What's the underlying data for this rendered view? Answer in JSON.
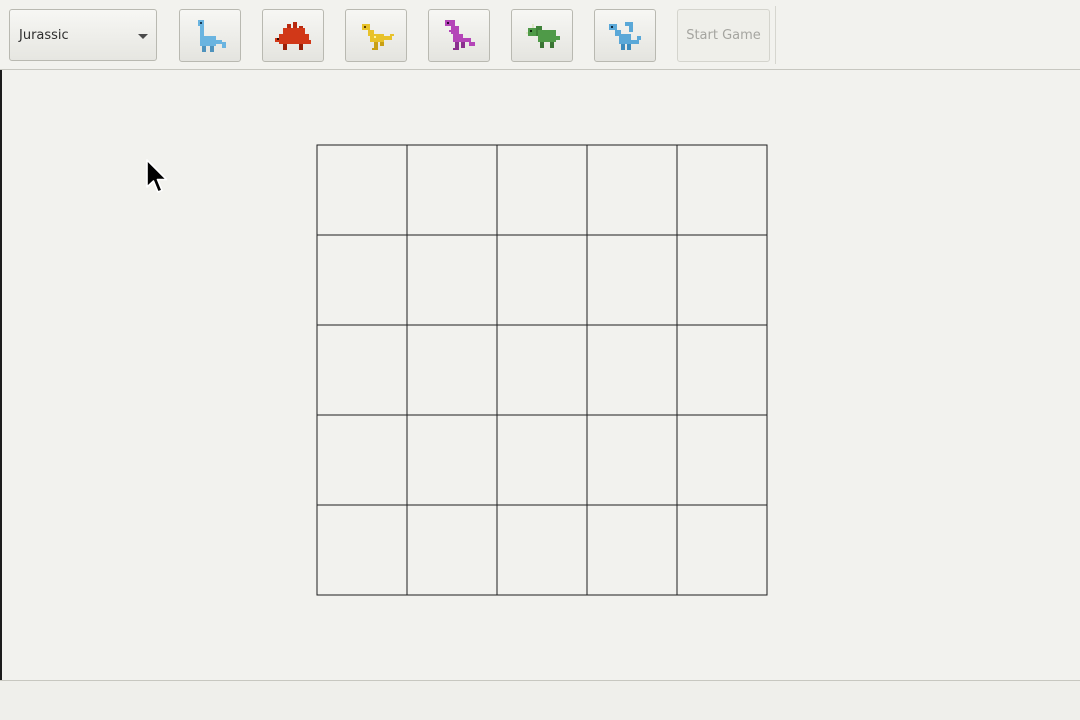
{
  "toolbar": {
    "era_select": {
      "value": "Jurassic",
      "icon": "chevron-down-icon"
    },
    "dino_buttons": [
      {
        "name": "blue-sauropod",
        "icon": "sauropod-icon",
        "color": "#6ab4e0"
      },
      {
        "name": "red-stegosaurus",
        "icon": "stegosaurus-icon",
        "color": "#d13818"
      },
      {
        "name": "yellow-raptor",
        "icon": "raptor-icon",
        "color": "#e8c22a"
      },
      {
        "name": "purple-trex",
        "icon": "trex-icon",
        "color": "#b445b8"
      },
      {
        "name": "green-triceratops",
        "icon": "triceratops-icon",
        "color": "#4f9a48"
      },
      {
        "name": "blue-dragon",
        "icon": "dragon-icon",
        "color": "#5aa8d8"
      }
    ],
    "start_button": {
      "label": "Start Game",
      "enabled": false
    }
  },
  "board": {
    "rows": 5,
    "cols": 5,
    "line_color": "#1f1f1f",
    "cells": [
      [
        "",
        "",
        "",
        "",
        ""
      ],
      [
        "",
        "",
        "",
        "",
        ""
      ],
      [
        "",
        "",
        "",
        "",
        ""
      ],
      [
        "",
        "",
        "",
        "",
        ""
      ],
      [
        "",
        "",
        "",
        "",
        ""
      ]
    ]
  },
  "status_bar": {
    "text": ""
  }
}
